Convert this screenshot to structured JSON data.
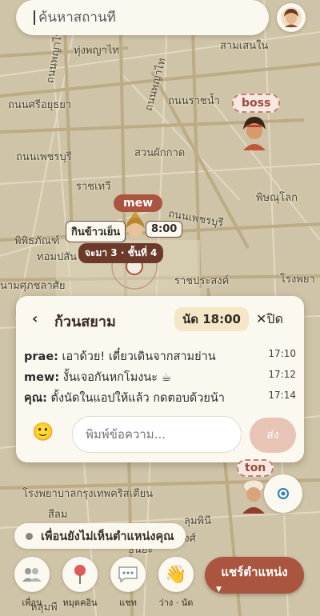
{
  "search": {
    "placeholder": "ค้นหาสถานที"
  },
  "map": {
    "labels": [
      "ทุ่งพญาไท",
      "สามเสนใน",
      "ถนนพญาไท",
      "ถนนศรีอยุธยา",
      "ถนนพญาไท",
      "ถนนราชน้ำ",
      "ถนนเพชรบุรี",
      "สวนผักกาด",
      "ราชเทวี",
      "พิษณุโลก",
      "ถนนเพชรบุรี",
      "พิพิธภัณฑ์",
      "ทอมปสัน",
      "นามศุภชลาศัย",
      "ราชประสงค์",
      "โรงพยา",
      "โรงพยาบาลกรุงเทพคริสเตียน",
      "สีลม",
      "สุรวงศ์",
      "ลุมพินี",
      "ธนิยะ",
      "หลุมพี"
    ]
  },
  "friends": {
    "boss": {
      "name": "boss"
    },
    "mew": {
      "name": "mew",
      "bubble_text": "กินข้าวเย็น",
      "bubble_time": "8:00",
      "status": "จะมา 3 · ชั้นที่ 4"
    },
    "ton": {
      "name": "ton"
    }
  },
  "chat": {
    "room_name": "ก้วนสยาม",
    "meet_time": "นัด 18:00",
    "close_label": "✕ปิด",
    "messages": [
      {
        "who": "prae:",
        "text": " เอาด้วย! เดี๋ยวเดินจากสามย่าน",
        "time": "17:10"
      },
      {
        "who": "mew:",
        "text": " งั้นเจอกันหกโมงนะ ☕",
        "time": "17:12"
      },
      {
        "who": "คุณ:",
        "text": " ตั้งนัดในแอปให้แล้ว กดตอบด้วยน้า",
        "time": "17:14"
      }
    ],
    "input_placeholder": "พิมพ์ข้อความ...",
    "send_label": "ส่ง"
  },
  "status_text": "เพื่อนยังไม่เห็นตำแหน่งคุณ",
  "bottom_nav": [
    {
      "label": "เพื่อน",
      "icon": "friends-icon"
    },
    {
      "label": "หมุดคอิน",
      "icon": "pin-icon"
    },
    {
      "label": "แชท",
      "icon": "chat-icon"
    },
    {
      "label": "ว่าง · นัด",
      "icon": "wave-icon"
    }
  ],
  "share_label": "แชร์ตำแหน่ง",
  "colors": {
    "accent": "#a9553f",
    "panel": "#fbf8ef",
    "map": "#cfc4a7"
  }
}
